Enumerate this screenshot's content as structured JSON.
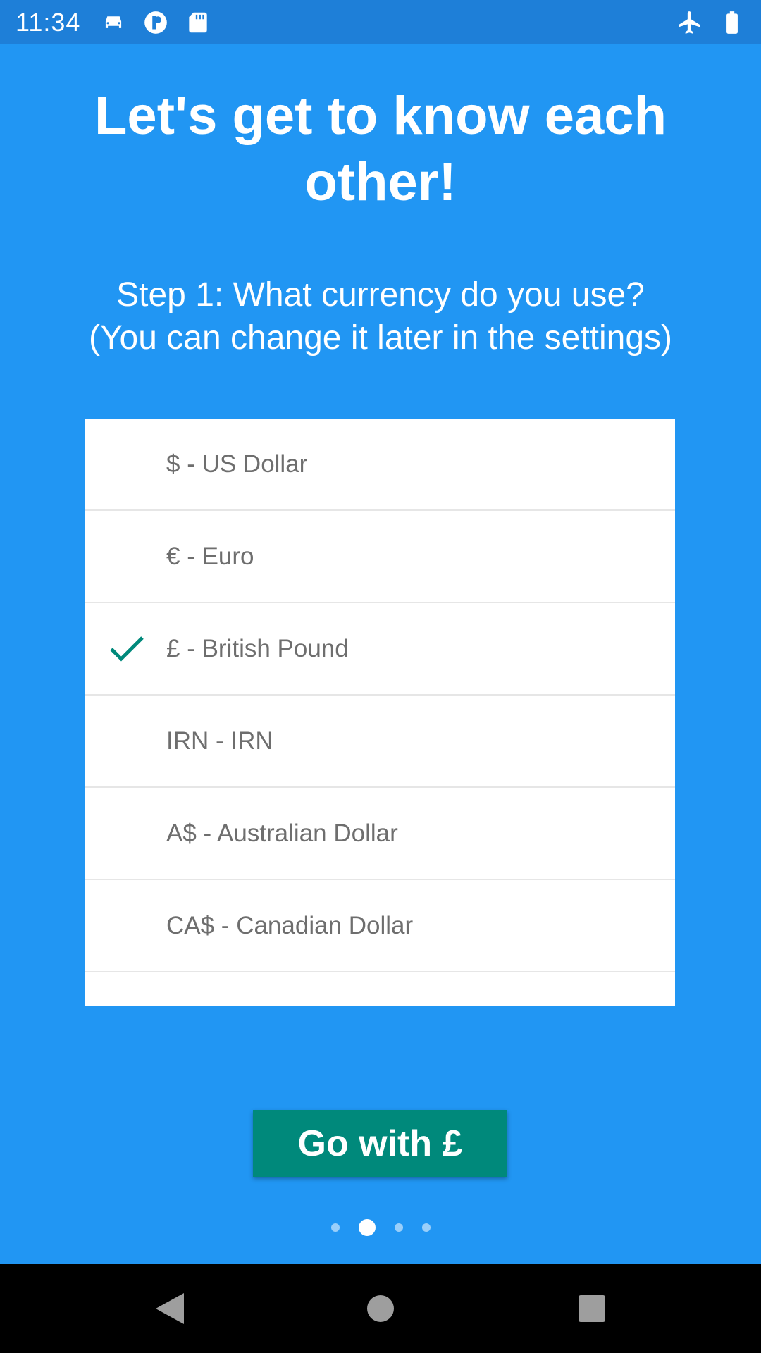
{
  "status_bar": {
    "time": "11:34",
    "left_icons": [
      "car-icon",
      "notification-app-icon",
      "sd-card-icon"
    ],
    "right_icons": [
      "airplane-mode-icon",
      "battery-icon"
    ]
  },
  "title": "Let's get to know each other!",
  "subtitle_line1": "Step 1: What currency do you use?",
  "subtitle_line2": "(You can change it later in the settings)",
  "currencies": [
    {
      "label": "$ - US Dollar",
      "selected": false
    },
    {
      "label": "€ - Euro",
      "selected": false
    },
    {
      "label": "£ - British Pound",
      "selected": true
    },
    {
      "label": "IRN - IRN",
      "selected": false
    },
    {
      "label": "A$ - Australian Dollar",
      "selected": false
    },
    {
      "label": "CA$ - Canadian Dollar",
      "selected": false
    },
    {
      "label": "",
      "selected": false
    }
  ],
  "go_button_label": "Go with £",
  "pager": {
    "total": 4,
    "current": 2
  },
  "colors": {
    "background": "#2196F3",
    "status_bar": "#1E7FD8",
    "accent": "#00897B"
  }
}
